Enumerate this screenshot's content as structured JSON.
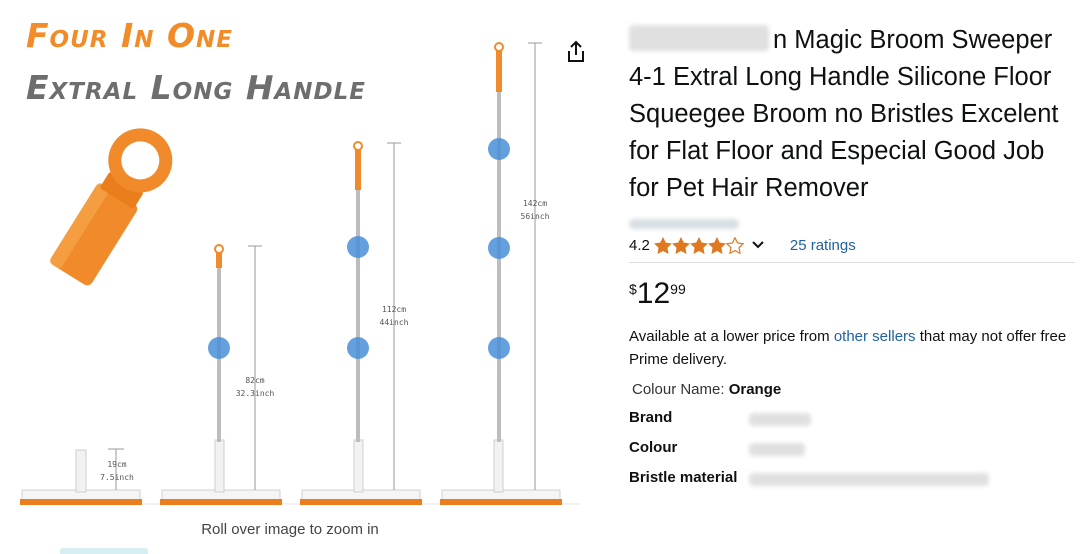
{
  "image": {
    "headline_1": "Four  in one",
    "headline_2": "Extral long handle",
    "measurements": [
      {
        "cm": "19cm",
        "inch": "7.5inch"
      },
      {
        "cm": "82cm",
        "inch": "32.3inch"
      },
      {
        "cm": "112cm",
        "inch": "44inch"
      },
      {
        "cm": "142cm",
        "inch": "56inch"
      }
    ],
    "zoom_hint": "Roll over image to zoom in",
    "accent_color": "#f28c28"
  },
  "share": {
    "icon": "share-icon"
  },
  "product": {
    "title_rest": "n Magic Broom Sweeper 4-1 Extral Long Handle Silicone Floor Squeegee Broom no Bristles Excelent for Flat Floor and Especial Good Job for Pet Hair Remover",
    "rating": {
      "value": "4.2",
      "stars": 4.2,
      "count_label": "25 ratings"
    },
    "price": {
      "symbol": "$",
      "whole": "12",
      "fraction": "99"
    },
    "lower_price": {
      "prefix": "Available at a lower price from ",
      "link": "other sellers",
      "suffix": " that may not offer free Prime delivery."
    },
    "colour": {
      "label": "Colour Name: ",
      "value": "Orange"
    },
    "specs": [
      {
        "key": "Brand"
      },
      {
        "key": "Colour"
      },
      {
        "key": "Bristle material"
      }
    ],
    "star_color": "#de7921",
    "link_color": "#2162a1"
  }
}
